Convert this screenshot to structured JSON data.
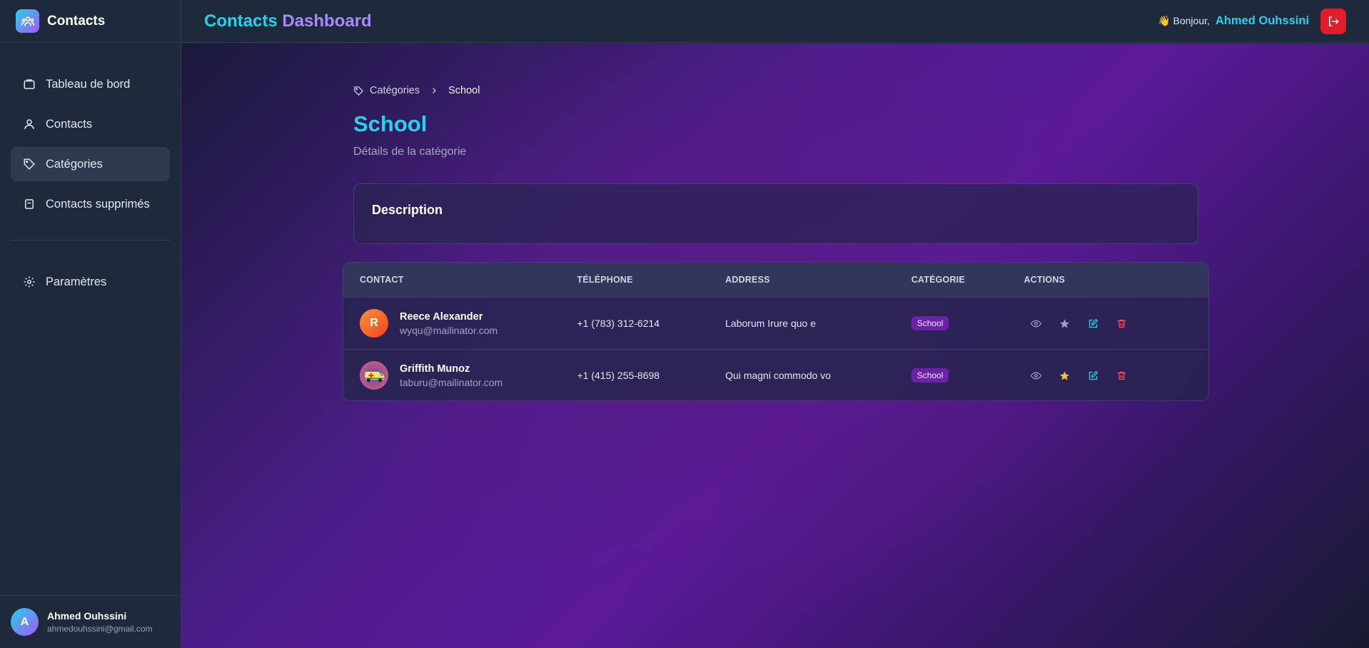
{
  "brand": {
    "name": "Contacts"
  },
  "sidebar": {
    "items": [
      {
        "label": "Tableau de bord",
        "icon": "dashboard-icon"
      },
      {
        "label": "Contacts",
        "icon": "user-icon"
      },
      {
        "label": "Catégories",
        "icon": "tag-icon",
        "active": true
      },
      {
        "label": "Contacts supprimés",
        "icon": "archive-icon"
      }
    ],
    "settings": {
      "label": "Paramètres",
      "icon": "gear-icon"
    },
    "user": {
      "initial": "A",
      "name": "Ahmed Ouhssini",
      "email": "ahmedouhssini@gmail.com"
    }
  },
  "header": {
    "title_part1": "Contacts",
    "title_part2": "Dashboard",
    "greeting": "👋 Bonjour,",
    "user_name": "Ahmed Ouhssini"
  },
  "breadcrumb": {
    "parent": "Catégories",
    "current": "School"
  },
  "page": {
    "title": "School",
    "subtitle": "Détails de la catégorie"
  },
  "description": {
    "title": "Description"
  },
  "table": {
    "headers": [
      "CONTACT",
      "TÉLÉPHONE",
      "ADDRESS",
      "CATÉGORIE",
      "ACTIONS"
    ],
    "rows": [
      {
        "initial": "R",
        "name": "Reece Alexander",
        "email": "wyqu@mailinator.com",
        "phone": "+1 (783) 312-6214",
        "address": "Laborum Irure quo e",
        "category": "School",
        "favorite": false
      },
      {
        "initial": "",
        "name": "Griffith Munoz",
        "email": "taburu@mailinator.com",
        "phone": "+1 (415) 255-8698",
        "address": "Qui magni commodo vo",
        "category": "School",
        "favorite": true
      }
    ]
  },
  "colors": {
    "accent": "#22d3ee",
    "accent2": "#a78bfa",
    "danger": "#e11d2a",
    "badge": "#6b21a8",
    "star": "#fbbf24"
  }
}
